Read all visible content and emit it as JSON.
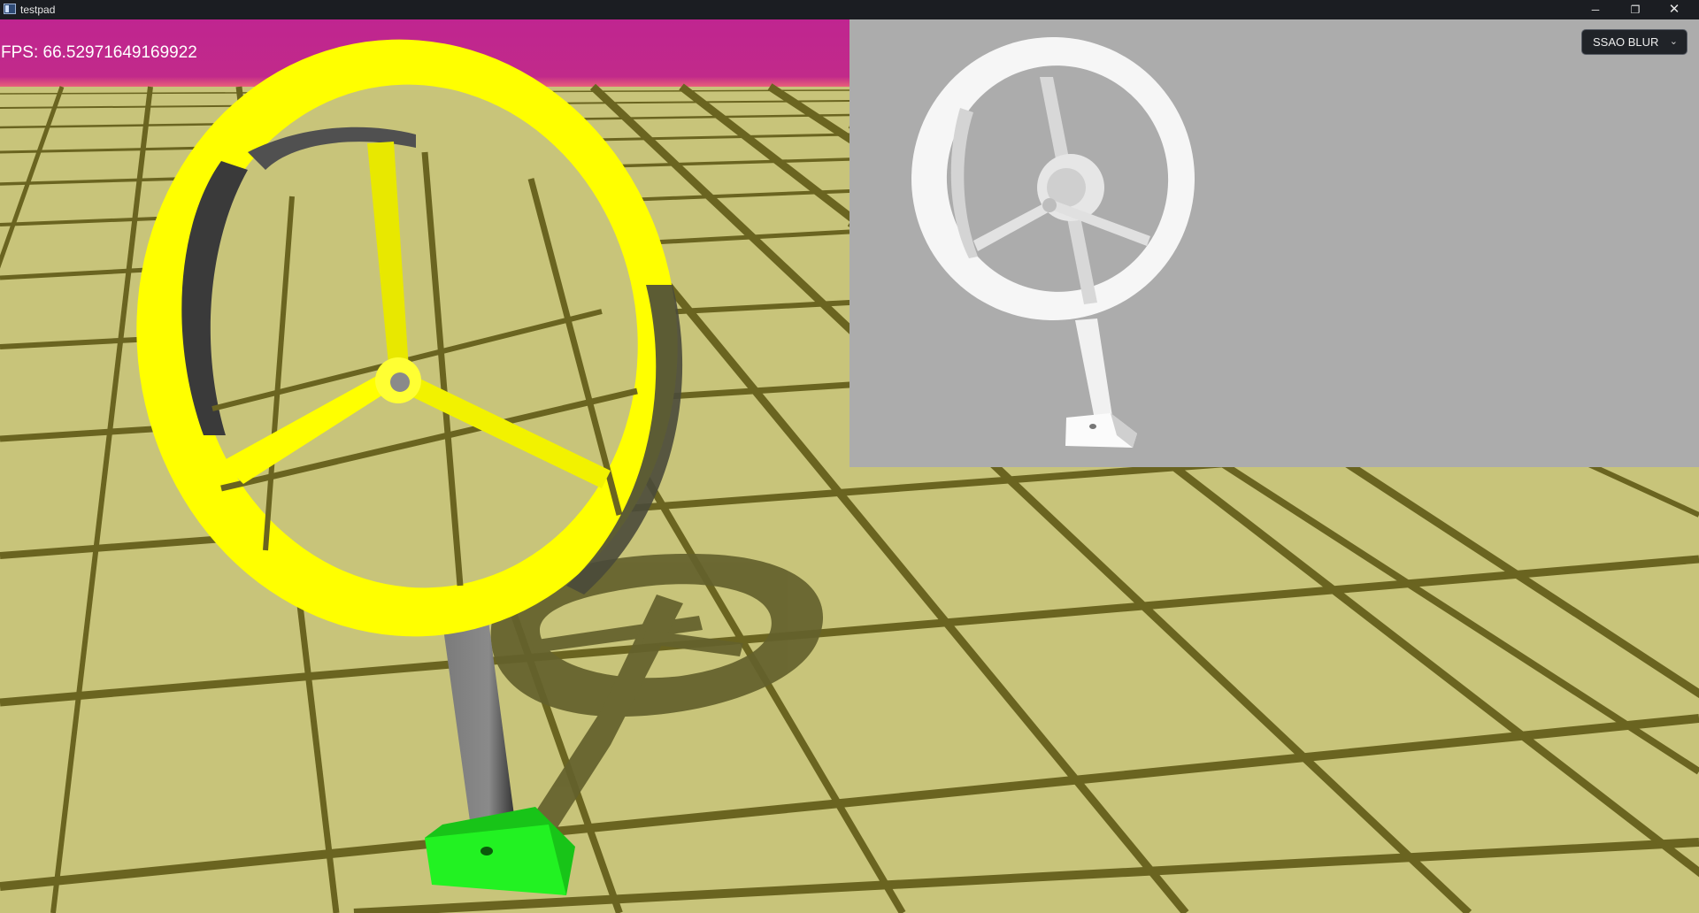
{
  "window": {
    "title": "testpad",
    "controls": {
      "minimize": "─",
      "restore": "❐",
      "close": "✕"
    }
  },
  "hud": {
    "fps_text": "FPS: 66.52971649169922"
  },
  "ssao_dropdown": {
    "selected": "SSAO BLUR",
    "chevron": "⌄"
  },
  "colors": {
    "sky": "#c02590",
    "floor": "#c8c47a",
    "grid_lines": "#6a6420",
    "wheel": "#ffff00",
    "stand": "#7f7f7f",
    "base": "#1fef1f",
    "ssao_background": "#acacac"
  },
  "icons": {
    "app": "window-icon",
    "minimize": "minimize-icon",
    "restore": "restore-icon",
    "close": "close-icon",
    "dropdown": "chevron-down-icon"
  }
}
